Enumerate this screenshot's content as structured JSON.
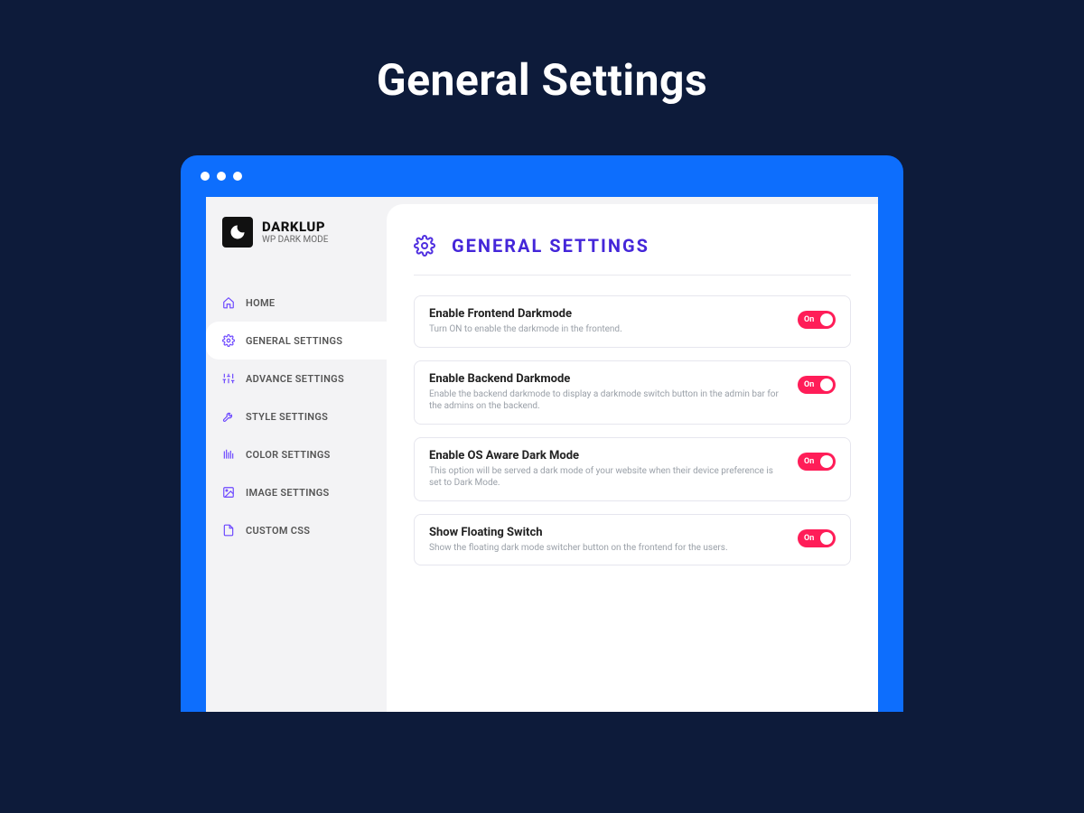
{
  "page": {
    "title": "General Settings"
  },
  "brand": {
    "name": "DARKLUP",
    "sub": "WP DARK MODE"
  },
  "sidebar": {
    "items": [
      {
        "label": "HOME",
        "icon": "home-icon",
        "active": false
      },
      {
        "label": "GENERAL SETTINGS",
        "icon": "gear-icon",
        "active": true
      },
      {
        "label": "ADVANCE SETTINGS",
        "icon": "sliders-icon",
        "active": false
      },
      {
        "label": "STYLE SETTINGS",
        "icon": "tools-icon",
        "active": false
      },
      {
        "label": "COLOR SETTINGS",
        "icon": "palette-icon",
        "active": false
      },
      {
        "label": "IMAGE SETTINGS",
        "icon": "image-icon",
        "active": false
      },
      {
        "label": "CUSTOM CSS",
        "icon": "code-icon",
        "active": false
      }
    ]
  },
  "content": {
    "title": "GENERAL SETTINGS",
    "toggle_label": "On",
    "settings": [
      {
        "title": "Enable Frontend Darkmode",
        "desc": "Turn ON to enable the darkmode in the frontend.",
        "on": true
      },
      {
        "title": "Enable Backend Darkmode",
        "desc": "Enable the backend darkmode to display a darkmode switch button in the admin bar for the admins on the backend.",
        "on": true
      },
      {
        "title": "Enable OS Aware Dark Mode",
        "desc": "This option will be served a dark mode of your website when their device preference is set to Dark Mode.",
        "on": true
      },
      {
        "title": "Show Floating Switch",
        "desc": "Show the floating dark mode switcher button on the frontend for the users.",
        "on": true
      }
    ]
  }
}
